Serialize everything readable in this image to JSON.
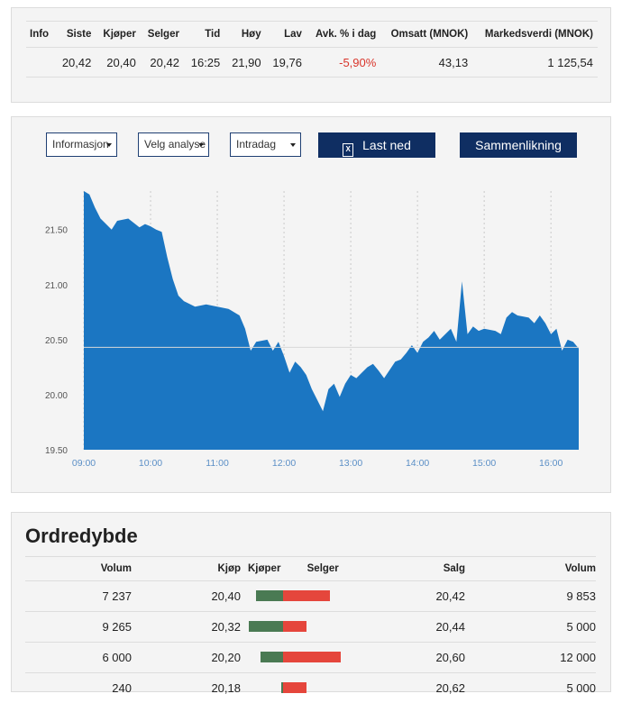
{
  "quote": {
    "headers": [
      "Info",
      "Siste",
      "Kjøper",
      "Selger",
      "Tid",
      "Høy",
      "Lav",
      "Avk. % i dag",
      "Omsatt (MNOK)",
      "Markedsverdi (MNOK)"
    ],
    "row": [
      "",
      "20,42",
      "20,40",
      "20,42",
      "16:25",
      "21,90",
      "19,76",
      "-5,90%",
      "43,13",
      "1 125,54"
    ]
  },
  "controls": {
    "info_select": "Informasjon",
    "analysis_select": "Velg analyse",
    "period_select": "Intradag",
    "download_label": "Last ned",
    "download_icon": "excel-file-icon",
    "compare_label": "Sammenlikning"
  },
  "chart_data": {
    "type": "area",
    "x_ticks": [
      "09:00",
      "10:00",
      "11:00",
      "12:00",
      "13:00",
      "14:00",
      "15:00",
      "16:00"
    ],
    "y_ticks": [
      "19.50",
      "20.00",
      "20.50",
      "21.00",
      "21.50"
    ],
    "ylim": [
      19.5,
      21.85
    ],
    "xlim": [
      "09:00",
      "16:25"
    ],
    "reference_line": 20.43,
    "grid": "dotted vertical",
    "fill_color": "#1b76c2",
    "series": [
      {
        "x": [
          "09:00",
          "09:05",
          "09:10",
          "09:15",
          "09:20",
          "09:25",
          "09:30",
          "09:40",
          "09:50",
          "09:55",
          "10:00",
          "10:05",
          "10:10",
          "10:15",
          "10:20",
          "10:25",
          "10:30",
          "10:40",
          "10:50",
          "11:00",
          "11:10",
          "11:20",
          "11:25",
          "11:30",
          "11:35",
          "11:45",
          "11:50",
          "11:55",
          "12:00",
          "12:05",
          "12:10",
          "12:15",
          "12:20",
          "12:25",
          "12:30",
          "12:35",
          "12:40",
          "12:45",
          "12:50",
          "12:55",
          "13:00",
          "13:05",
          "13:10",
          "13:15",
          "13:20",
          "13:25",
          "13:30",
          "13:40",
          "13:45",
          "13:50",
          "13:55",
          "14:00",
          "14:05",
          "14:10",
          "14:15",
          "14:20",
          "14:25",
          "14:30",
          "14:35",
          "14:40",
          "14:45",
          "14:50",
          "14:55",
          "15:00",
          "15:10",
          "15:15",
          "15:20",
          "15:25",
          "15:30",
          "15:40",
          "15:45",
          "15:50",
          "15:55",
          "16:00",
          "16:05",
          "16:10",
          "16:15",
          "16:20",
          "16:25"
        ],
        "y": [
          21.85,
          21.82,
          21.7,
          21.6,
          21.55,
          21.5,
          21.58,
          21.6,
          21.52,
          21.55,
          21.53,
          21.5,
          21.48,
          21.25,
          21.05,
          20.9,
          20.85,
          20.8,
          20.82,
          20.8,
          20.78,
          20.72,
          20.6,
          20.4,
          20.48,
          20.5,
          20.4,
          20.48,
          20.35,
          20.2,
          20.3,
          20.25,
          20.18,
          20.05,
          19.95,
          19.85,
          20.05,
          20.1,
          19.98,
          20.1,
          20.18,
          20.15,
          20.2,
          20.25,
          20.28,
          20.22,
          20.15,
          20.3,
          20.32,
          20.38,
          20.45,
          20.38,
          20.48,
          20.52,
          20.58,
          20.5,
          20.55,
          20.6,
          20.48,
          21.03,
          20.55,
          20.62,
          20.58,
          20.6,
          20.58,
          20.55,
          20.7,
          20.75,
          20.72,
          20.7,
          20.65,
          20.72,
          20.65,
          20.55,
          20.6,
          20.4,
          20.5,
          20.48,
          20.42
        ]
      }
    ]
  },
  "depth": {
    "title": "Ordredybde",
    "headers": [
      "Volum",
      "Kjøp",
      "Kjøper",
      "Selger",
      "Salg",
      "Volum"
    ],
    "rows": [
      {
        "buy_volume": "7 237",
        "buy_price": "20,40",
        "sell_price": "20,42",
        "sell_volume": "9 853",
        "buy_bar": 0.58,
        "sell_bar": 0.79
      },
      {
        "buy_volume": "9 265",
        "buy_price": "20,32",
        "sell_price": "20,44",
        "sell_volume": "5 000",
        "buy_bar": 0.74,
        "sell_bar": 0.4
      },
      {
        "buy_volume": "6 000",
        "buy_price": "20,20",
        "sell_price": "20,60",
        "sell_volume": "12 000",
        "buy_bar": 0.48,
        "sell_bar": 0.97
      },
      {
        "buy_volume": "240",
        "buy_price": "20,18",
        "sell_price": "20,62",
        "sell_volume": "5 000",
        "buy_bar": 0.02,
        "sell_bar": 0.4
      }
    ],
    "buy_color": "#4a7a53",
    "sell_color": "#e5463c"
  }
}
